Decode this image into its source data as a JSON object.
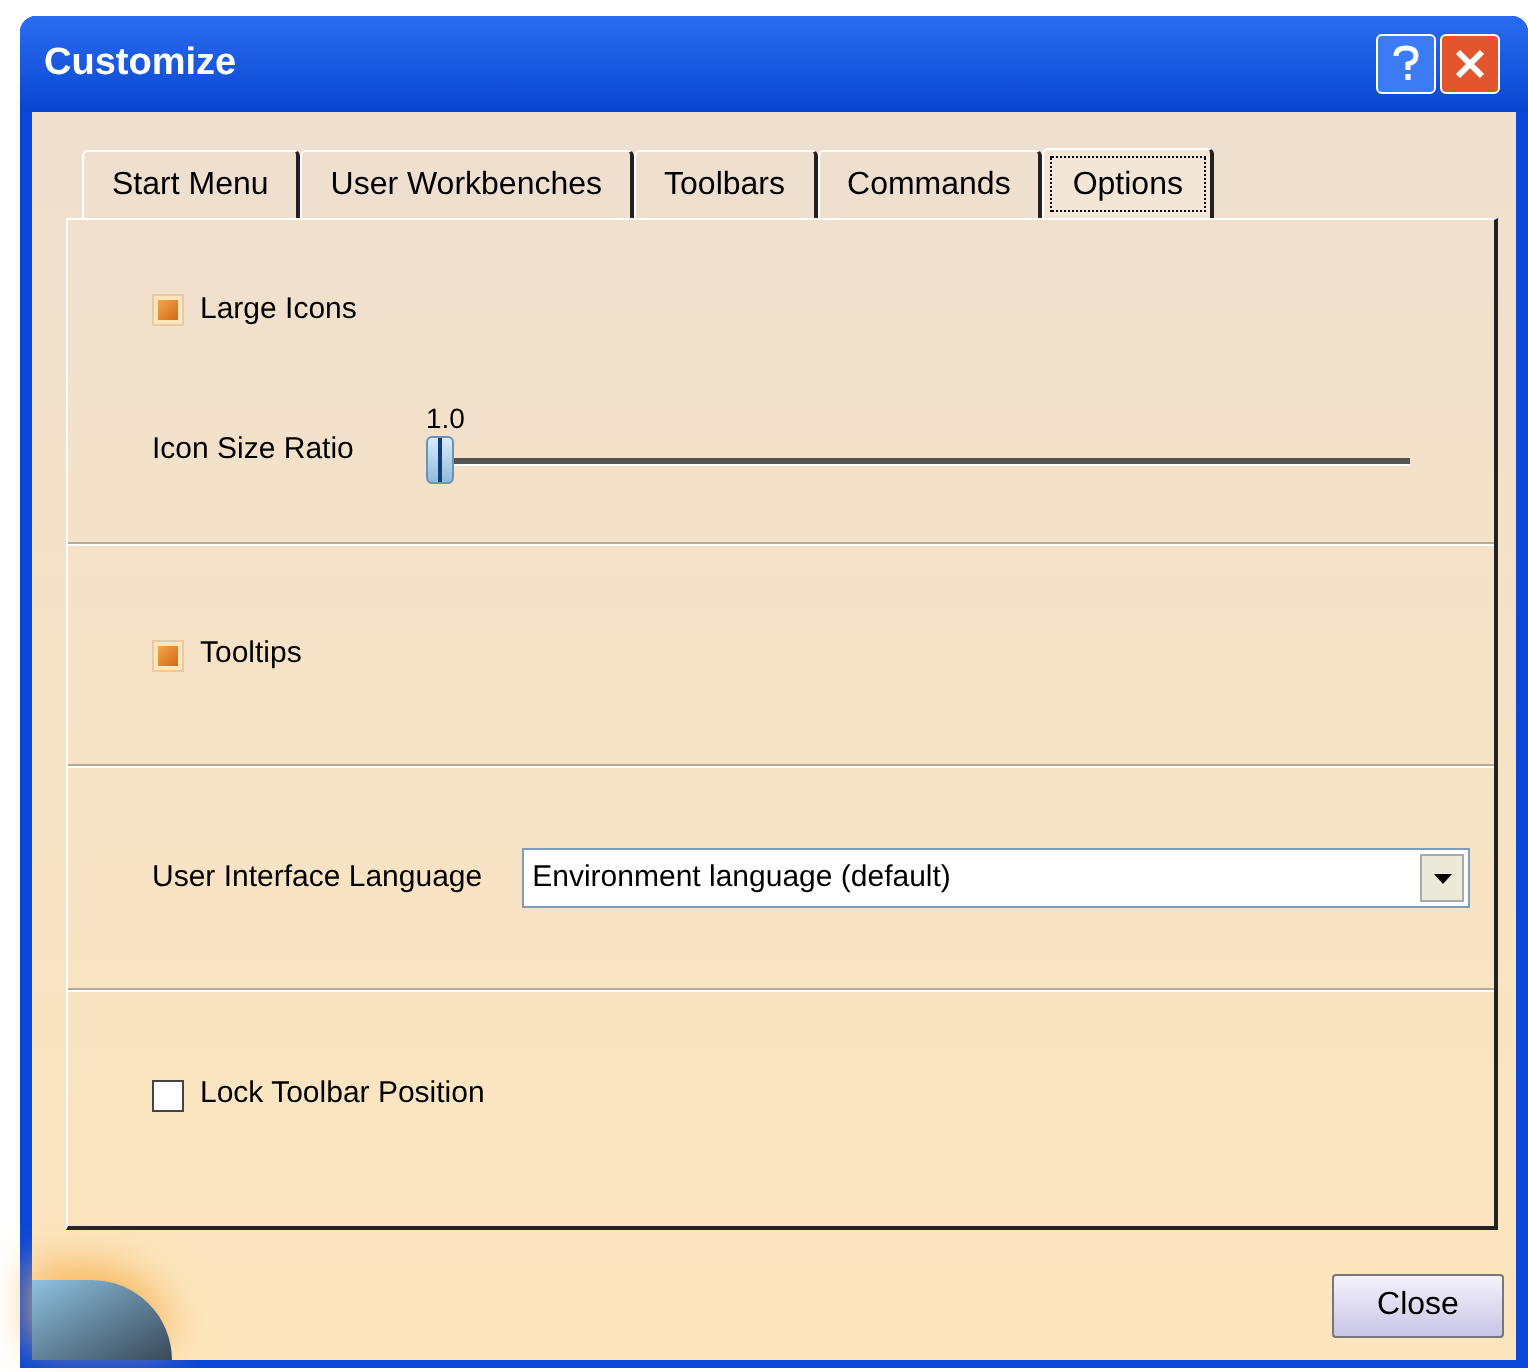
{
  "window": {
    "title": "Customize"
  },
  "tabs": [
    {
      "label": "Start Menu",
      "selected": false
    },
    {
      "label": "User Workbenches",
      "selected": false
    },
    {
      "label": "Toolbars",
      "selected": false
    },
    {
      "label": "Commands",
      "selected": false
    },
    {
      "label": "Options",
      "selected": true
    }
  ],
  "large_icons": {
    "label": "Large Icons",
    "checked": true
  },
  "icon_size_ratio": {
    "label": "Icon Size Ratio",
    "reading": "1.0",
    "level": 0
  },
  "tooltips": {
    "label": "Tooltips",
    "checked": true
  },
  "language": {
    "label": "User Interface Language",
    "value": "Environment language (default)"
  },
  "lock_toolbar": {
    "label": "Lock Toolbar Position",
    "checked": false
  },
  "buttons": [
    "Close"
  ]
}
